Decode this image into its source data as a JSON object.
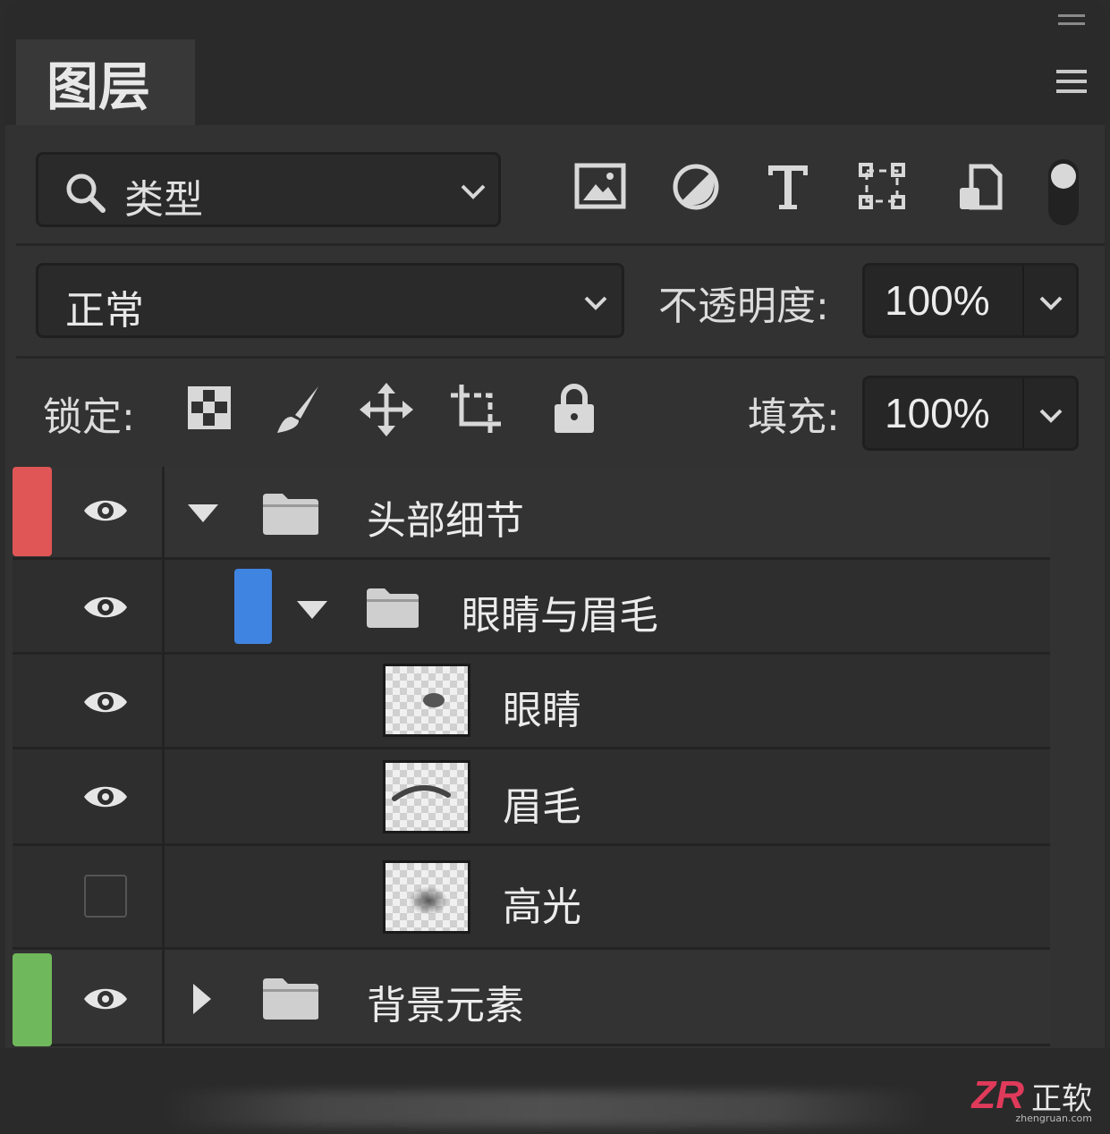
{
  "panel": {
    "tab_title": "图层"
  },
  "filter": {
    "kind_label": "类型",
    "icons": [
      "image-filter-icon",
      "adjustment-filter-icon",
      "type-filter-icon",
      "shape-filter-icon",
      "smart-object-filter-icon",
      "filter-toggle-icon"
    ]
  },
  "blend": {
    "mode": "正常",
    "opacity_label": "不透明度:",
    "opacity_value": "100%"
  },
  "lock": {
    "label": "锁定:",
    "fill_label": "填充:",
    "fill_value": "100%",
    "icons": [
      "lock-transparent-icon",
      "lock-image-icon",
      "lock-position-icon",
      "lock-artboard-icon",
      "lock-all-icon"
    ]
  },
  "layers": [
    {
      "name": "头部细节",
      "type": "group",
      "expanded": true,
      "visible": true,
      "color": "#e05555",
      "depth": 0
    },
    {
      "name": "眼睛与眉毛",
      "type": "group",
      "expanded": true,
      "visible": true,
      "color": "#3f84e0",
      "depth": 1
    },
    {
      "name": "眼睛",
      "type": "pixel",
      "visible": true,
      "depth": 2
    },
    {
      "name": "眉毛",
      "type": "pixel",
      "visible": true,
      "depth": 2
    },
    {
      "name": "高光",
      "type": "pixel",
      "visible": false,
      "depth": 2
    },
    {
      "name": "背景元素",
      "type": "group",
      "expanded": false,
      "visible": true,
      "color": "#6fb85b",
      "depth": 0
    }
  ],
  "watermark": {
    "logo": "ZR",
    "text": "正软",
    "url": "zhengruan.com"
  }
}
